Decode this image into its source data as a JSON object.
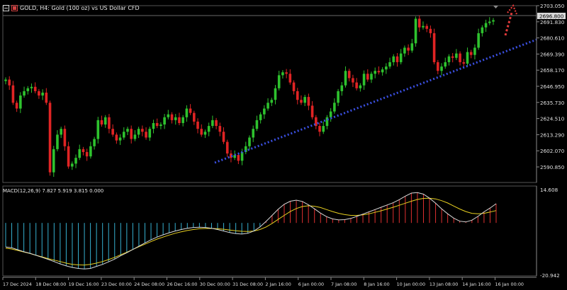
{
  "header": {
    "title": "GOLD, H4:  Gold (100 oz) vs US Dollar CFD"
  },
  "macd_header": {
    "label": "MACD(12,26,9) 7.827 5.919 3.815 0.000"
  },
  "colors": {
    "bull": "#2ec22e",
    "bear": "#e02424",
    "trendline": "#3a4fe0",
    "forecast_arrow": "#e03a3a",
    "macd_line": "#d8d8d8",
    "signal_line": "#e8d020",
    "hist_pos": "#e03030",
    "hist_neg": "#36b0d0",
    "axis": "#8a8a8a",
    "text": "#e0e0e0"
  },
  "price_axis": {
    "labels": [
      "2703.050",
      "2691.830",
      "2680.610",
      "2669.390",
      "2658.170",
      "2646.950",
      "2635.730",
      "2624.510",
      "2613.290",
      "2602.070",
      "2590.850"
    ],
    "current": "2696.800"
  },
  "macd_axis": {
    "top": "14.608",
    "bottom": "-20.942"
  },
  "time_axis": [
    "17 Dec 2024",
    "18 Dec 08:00",
    "19 Dec 16:00",
    "23 Dec 00:00",
    "24 Dec 08:00",
    "26 Dec 16:00",
    "30 Dec 00:00",
    "31 Dec 08:00",
    "2 Jan 16:00",
    "6 Jan 00:00",
    "7 Jan 08:00",
    "8 Jan 16:00",
    "10 Jan 00:00",
    "13 Jan 08:00",
    "14 Jan 16:00",
    "16 Jan 00:00"
  ],
  "chart_data": {
    "type": "candlestick",
    "symbol": "GOLD",
    "timeframe": "H4",
    "ylim": [
      2585,
      2707
    ],
    "close_series": [
      2656,
      2652,
      2640,
      2636,
      2645,
      2648,
      2650,
      2651,
      2648,
      2645,
      2647,
      2640,
      2592,
      2608,
      2618,
      2622,
      2610,
      2596,
      2598,
      2602,
      2608,
      2606,
      2603,
      2610,
      2615,
      2628,
      2625,
      2630,
      2622,
      2618,
      2614,
      2616,
      2620,
      2622,
      2615,
      2618,
      2622,
      2620,
      2616,
      2622,
      2626,
      2624,
      2625,
      2630,
      2632,
      2628,
      2630,
      2626,
      2630,
      2636,
      2633,
      2627,
      2622,
      2618,
      2620,
      2624,
      2628,
      2624,
      2620,
      2613,
      2605,
      2602,
      2604,
      2600,
      2606,
      2610,
      2616,
      2622,
      2628,
      2632,
      2636,
      2640,
      2642,
      2650,
      2659,
      2661,
      2660,
      2654,
      2648,
      2642,
      2640,
      2644,
      2638,
      2630,
      2624,
      2620,
      2624,
      2630,
      2634,
      2640,
      2648,
      2652,
      2662,
      2657,
      2654,
      2650,
      2652,
      2660,
      2656,
      2660,
      2662,
      2661,
      2663,
      2665,
      2668,
      2672,
      2668,
      2674,
      2678,
      2676,
      2681,
      2698,
      2692,
      2693,
      2691,
      2688,
      2668,
      2662,
      2665,
      2668,
      2672,
      2671,
      2674,
      2668,
      2667,
      2675,
      2673,
      2678,
      2688,
      2692,
      2695,
      2696,
      2697
    ],
    "trendline": {
      "from": [
        "30 Dec 00:00",
        2595
      ],
      "to": [
        "16 Jan 00:00",
        2682
      ]
    },
    "macd": [
      -9.5,
      -9.8,
      -10.6,
      -11.4,
      -12.0,
      -12.8,
      -13.6,
      -14.4,
      -15.3,
      -16.2,
      -17.0,
      -17.6,
      -18.0,
      -18.2,
      -18.0,
      -17.2,
      -16.4,
      -15.4,
      -14.3,
      -13.0,
      -11.8,
      -10.5,
      -9.2,
      -7.9,
      -6.7,
      -5.6,
      -4.7,
      -3.9,
      -3.2,
      -2.6,
      -2.1,
      -1.8,
      -1.7,
      -1.8,
      -2.1,
      -2.6,
      -3.2,
      -3.8,
      -4.2,
      -4.4,
      -4.1,
      -3.2,
      -1.6,
      0.6,
      3.0,
      5.4,
      7.4,
      8.6,
      9.0,
      8.5,
      7.2,
      5.6,
      3.9,
      2.5,
      1.6,
      1.2,
      1.3,
      1.8,
      2.6,
      3.5,
      4.4,
      5.3,
      6.2,
      7.1,
      8.0,
      9.2,
      10.6,
      11.8,
      12.0,
      11.4,
      9.8,
      7.8,
      5.6,
      3.6,
      1.9,
      0.7,
      0.4,
      1.1,
      2.6,
      4.4,
      5.9,
      7.6
    ],
    "signal": [
      -10.0,
      -10.3,
      -10.9,
      -11.5,
      -12.1,
      -12.8,
      -13.4,
      -14.1,
      -14.7,
      -15.3,
      -15.9,
      -16.4,
      -16.6,
      -16.7,
      -16.4,
      -15.9,
      -15.3,
      -14.5,
      -13.6,
      -12.6,
      -11.6,
      -10.5,
      -9.4,
      -8.4,
      -7.4,
      -6.4,
      -5.6,
      -4.8,
      -4.1,
      -3.5,
      -3.0,
      -2.6,
      -2.3,
      -2.2,
      -2.2,
      -2.3,
      -2.5,
      -2.8,
      -3.1,
      -3.3,
      -3.4,
      -3.2,
      -2.6,
      -1.6,
      -0.2,
      1.4,
      3.0,
      4.5,
      5.7,
      6.5,
      6.8,
      6.6,
      6.1,
      5.3,
      4.5,
      3.8,
      3.3,
      3.0,
      3.0,
      3.2,
      3.6,
      4.2,
      4.8,
      5.5,
      6.2,
      7.0,
      7.8,
      8.6,
      9.3,
      9.7,
      9.8,
      9.5,
      8.8,
      7.9,
      6.7,
      5.5,
      4.5,
      3.8,
      3.6,
      3.8,
      4.3,
      4.9
    ],
    "macd_ylim": [
      -20.942,
      14.608
    ]
  }
}
